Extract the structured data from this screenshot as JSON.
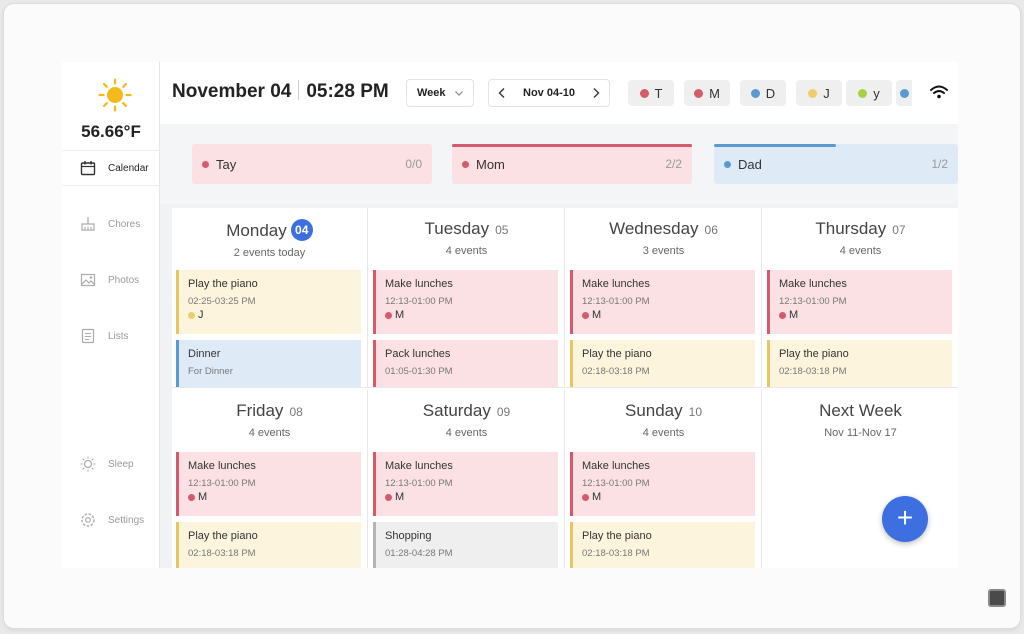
{
  "weather": {
    "temperature": "56.66°F",
    "icon": "sun-icon"
  },
  "sidebar": {
    "items": [
      {
        "label": "Calendar",
        "icon": "calendar-icon",
        "active": true
      },
      {
        "label": "Chores",
        "icon": "broom-icon"
      },
      {
        "label": "Photos",
        "icon": "photo-icon"
      },
      {
        "label": "Lists",
        "icon": "list-icon"
      },
      {
        "label": "Sleep",
        "icon": "sleep-icon"
      },
      {
        "label": "Settings",
        "icon": "gear-icon"
      }
    ]
  },
  "header": {
    "date": "November 04",
    "time": "05:28 PM",
    "view": "Week",
    "range": "Nov 04-10"
  },
  "filters": [
    {
      "label": "T",
      "color": "#d55a6b"
    },
    {
      "label": "M",
      "color": "#d55a6b"
    },
    {
      "label": "D",
      "color": "#5a9ad0"
    },
    {
      "label": "J",
      "color": "#ecce6a"
    },
    {
      "label": "y",
      "color": "#a7d046"
    }
  ],
  "members": [
    {
      "name": "Tay",
      "count": "0/0",
      "color": "#d55a6b",
      "bg": "#fbe1e4"
    },
    {
      "name": "Mom",
      "count": "2/2",
      "color": "#d55a6b",
      "bg": "#fbe1e4"
    },
    {
      "name": "Dad",
      "count": "1/2",
      "color": "#5a9ad0",
      "bg": "#deebf7"
    }
  ],
  "days": [
    {
      "name": "Monday",
      "num": "04",
      "today": true,
      "sub": "2 events today",
      "events": [
        {
          "title": "Play the piano",
          "time": "02:25-03:25 PM",
          "who": "J",
          "who_color": "#ecce6a",
          "color": "yellow"
        },
        {
          "title": "Dinner",
          "time": "For Dinner",
          "who": "",
          "color": "blue"
        }
      ]
    },
    {
      "name": "Tuesday",
      "num": "05",
      "sub": "4 events",
      "events": [
        {
          "title": "Make lunches",
          "time": "12:13-01:00 PM",
          "who": "M",
          "who_color": "#d55a6b",
          "color": "red"
        },
        {
          "title": "Pack lunches",
          "time": "01:05-01:30 PM",
          "who": "",
          "color": "red"
        }
      ]
    },
    {
      "name": "Wednesday",
      "num": "06",
      "sub": "3 events",
      "events": [
        {
          "title": "Make lunches",
          "time": "12:13-01:00 PM",
          "who": "M",
          "who_color": "#d55a6b",
          "color": "red"
        },
        {
          "title": "Play the piano",
          "time": "02:18-03:18 PM",
          "who": "",
          "color": "yellow"
        }
      ]
    },
    {
      "name": "Thursday",
      "num": "07",
      "sub": "4 events",
      "events": [
        {
          "title": "Make lunches",
          "time": "12:13-01:00 PM",
          "who": "M",
          "who_color": "#d55a6b",
          "color": "red"
        },
        {
          "title": "Play the piano",
          "time": "02:18-03:18 PM",
          "who": "",
          "color": "yellow"
        }
      ]
    },
    {
      "name": "Friday",
      "num": "08",
      "sub": "4 events",
      "events": [
        {
          "title": "Make lunches",
          "time": "12:13-01:00 PM",
          "who": "M",
          "who_color": "#d55a6b",
          "color": "red"
        },
        {
          "title": "Play the piano",
          "time": "02:18-03:18 PM",
          "who": "",
          "color": "yellow"
        }
      ]
    },
    {
      "name": "Saturday",
      "num": "09",
      "sub": "4 events",
      "events": [
        {
          "title": "Make lunches",
          "time": "12:13-01:00 PM",
          "who": "M",
          "who_color": "#d55a6b",
          "color": "red"
        },
        {
          "title": "Shopping",
          "time": "01:28-04:28 PM",
          "who": "",
          "color": "gray"
        }
      ]
    },
    {
      "name": "Sunday",
      "num": "10",
      "sub": "4 events",
      "events": [
        {
          "title": "Make lunches",
          "time": "12:13-01:00 PM",
          "who": "M",
          "who_color": "#d55a6b",
          "color": "red"
        },
        {
          "title": "Play the piano",
          "time": "02:18-03:18 PM",
          "who": "",
          "color": "yellow"
        }
      ]
    },
    {
      "name": "Next Week",
      "num": "",
      "sub": "Nov 11-Nov 17",
      "events": []
    }
  ],
  "fab": {
    "label": "+"
  }
}
